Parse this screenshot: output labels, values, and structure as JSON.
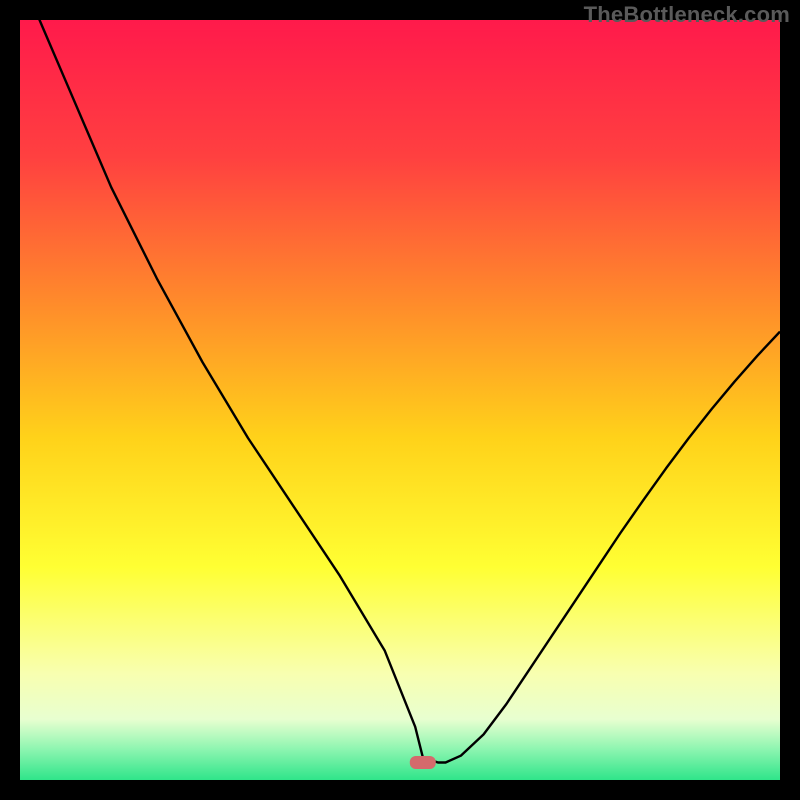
{
  "watermark": "TheBottleneck.com",
  "chart_data": {
    "type": "line",
    "title": "",
    "xlabel": "",
    "ylabel": "",
    "xlim": [
      0,
      100
    ],
    "ylim": [
      0,
      100
    ],
    "marker": {
      "x": 53,
      "y": 2.3
    },
    "gradient_stops": [
      {
        "offset": 0,
        "color": "#ff1a4b"
      },
      {
        "offset": 18,
        "color": "#ff4040"
      },
      {
        "offset": 38,
        "color": "#ff8e2a"
      },
      {
        "offset": 55,
        "color": "#ffd21a"
      },
      {
        "offset": 72,
        "color": "#ffff33"
      },
      {
        "offset": 86,
        "color": "#f8ffb0"
      },
      {
        "offset": 92,
        "color": "#e8ffd0"
      },
      {
        "offset": 96,
        "color": "#8cf5b0"
      },
      {
        "offset": 100,
        "color": "#2fe58a"
      }
    ],
    "series": [
      {
        "name": "bottleneck-curve",
        "x": [
          0,
          3,
          6,
          9,
          12,
          15,
          18,
          21,
          24,
          27,
          30,
          33,
          36,
          39,
          42,
          45,
          48,
          50,
          52,
          53,
          55,
          56,
          58,
          61,
          64,
          67,
          70,
          73,
          76,
          79,
          82,
          85,
          88,
          91,
          94,
          97,
          100
        ],
        "values": [
          106,
          99,
          92,
          85,
          78,
          72,
          66,
          60.5,
          55,
          50,
          45,
          40.5,
          36,
          31.5,
          27,
          22,
          17,
          12,
          7,
          3,
          2.3,
          2.3,
          3.2,
          6,
          10,
          14.5,
          19,
          23.5,
          28,
          32.5,
          36.8,
          41,
          45,
          48.8,
          52.4,
          55.8,
          59
        ]
      }
    ]
  }
}
